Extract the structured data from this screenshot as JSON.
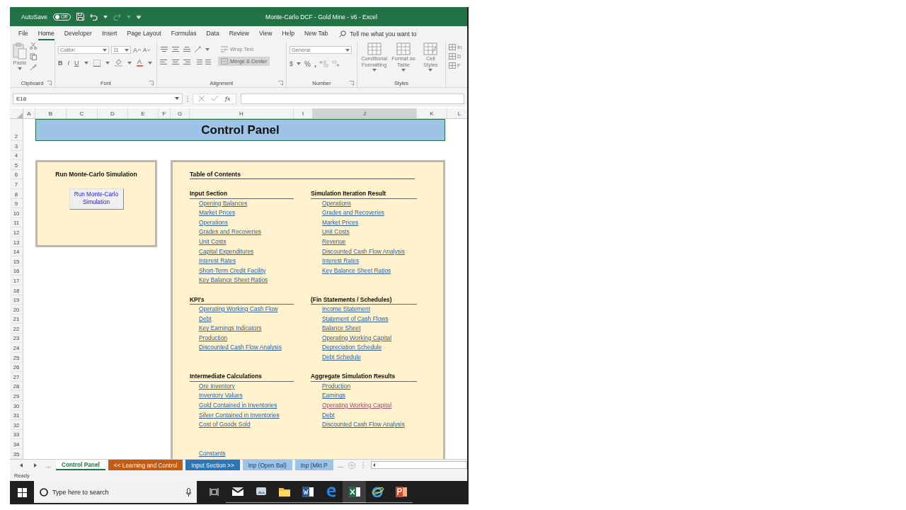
{
  "title_bar": {
    "autosave_label": "AutoSave",
    "autosave": {
      "on": false,
      "label": "Off"
    },
    "title": "Monte-Carlo DCF - Gold Mine - v6  -  Excel"
  },
  "menu_tabs": [
    {
      "label": "File",
      "selected": false
    },
    {
      "label": "Home",
      "selected": true
    },
    {
      "label": "Developer",
      "selected": false
    },
    {
      "label": "Insert",
      "selected": false
    },
    {
      "label": "Page Layout",
      "selected": false
    },
    {
      "label": "Formulas",
      "selected": false
    },
    {
      "label": "Data",
      "selected": false
    },
    {
      "label": "Review",
      "selected": false
    },
    {
      "label": "View",
      "selected": false
    },
    {
      "label": "Help",
      "selected": false
    },
    {
      "label": "New Tab",
      "selected": false
    }
  ],
  "tell_me": {
    "placeholder": "Tell me what you want to"
  },
  "ribbon": {
    "clipboard": {
      "paste": "Paste",
      "label": "Clipboard"
    },
    "font": {
      "name": "Calibri",
      "size": "11",
      "grow": "A",
      "shrink": "A",
      "bold": "B",
      "italic": "I",
      "underline": "U",
      "font_color_button": "A",
      "label": "Font"
    },
    "alignment": {
      "wrap": "Wrap Text",
      "merge": "Merge & Center",
      "label": "Alignment"
    },
    "number": {
      "format": "General",
      "currency": "$",
      "percent": "%",
      "comma": ",",
      "label": "Number"
    },
    "styles": {
      "items": [
        "Conditional Formatting",
        "Format as Table",
        "Cell Styles"
      ],
      "label": "Styles"
    },
    "cells_partial": [
      "In",
      "D",
      "F"
    ]
  },
  "formula_bar": {
    "name_box": "E18",
    "fx": "fx"
  },
  "column_headers": [
    {
      "label": "A",
      "selected": false
    },
    {
      "label": "B",
      "selected": false
    },
    {
      "label": "C",
      "selected": false
    },
    {
      "label": "D",
      "selected": false
    },
    {
      "label": "E",
      "selected": false
    },
    {
      "label": "F",
      "selected": false
    },
    {
      "label": "G",
      "selected": false
    },
    {
      "label": "H",
      "selected": false
    },
    {
      "label": "I",
      "selected": false
    },
    {
      "label": "J",
      "selected": true
    },
    {
      "label": "K",
      "selected": false
    },
    {
      "label": "L",
      "selected": false
    }
  ],
  "row_numbers": [
    "2",
    "3",
    "4",
    "5",
    "6",
    "7",
    "8",
    "9",
    "10",
    "11",
    "12",
    "13",
    "14",
    "15",
    "16",
    "17",
    "18",
    "19",
    "20",
    "21",
    "22",
    "23",
    "24",
    "25",
    "26",
    "27",
    "28",
    "29",
    "30",
    "31",
    "32",
    "33",
    "34",
    "35"
  ],
  "banner": {
    "title": "Control Panel"
  },
  "simulation_panel": {
    "title": "Run Monte-Carlo Simulation",
    "button": "Run Monte-Carlo Simulation"
  },
  "toc": {
    "title": "Table of Contents",
    "columns": [
      [
        {
          "heading": "Input Section",
          "links": [
            {
              "label": "Opening  Balances",
              "visited": false
            },
            {
              "label": "Market Prices",
              "visited": false
            },
            {
              "label": "Operations",
              "visited": false
            },
            {
              "label": "Grades and Recoveries",
              "visited": false
            },
            {
              "label": "Unit Costs",
              "visited": false
            },
            {
              "label": "Capital Expenditures",
              "visited": false
            },
            {
              "label": "Interest Rates",
              "visited": false
            },
            {
              "label": "Short-Term Credit Facility",
              "visited": false
            },
            {
              "label": "Key Balance Sheet Ratios",
              "visited": false
            }
          ]
        },
        {
          "heading": "KPI's",
          "links": [
            {
              "label": "Operating Working Cash Flow",
              "visited": false
            },
            {
              "label": "Debt",
              "visited": false
            },
            {
              "label": "Key Earnings Indicators",
              "visited": false
            },
            {
              "label": "Production",
              "visited": false
            },
            {
              "label": "Discounted Cash Flow Analysis",
              "visited": false
            }
          ]
        },
        {
          "heading": "Intermediate Calculations",
          "links": [
            {
              "label": "Ore Inventory",
              "visited": false
            },
            {
              "label": "Inventory Values",
              "visited": false
            },
            {
              "label": "Gold Contained in Inventories",
              "visited": false
            },
            {
              "label": "Silver Contained in Inventories",
              "visited": false
            },
            {
              "label": "Cost of Goods Sold",
              "visited": false
            }
          ]
        },
        {
          "links": [
            {
              "label": "Constants",
              "visited": false
            }
          ]
        }
      ],
      [
        {
          "heading": "Simulation Iteration Result",
          "links": [
            {
              "label": "Operations",
              "visited": false
            },
            {
              "label": "Grades and Recoveries",
              "visited": false
            },
            {
              "label": "Market Prices",
              "visited": false
            },
            {
              "label": "Unit Costs",
              "visited": false
            },
            {
              "label": "Revenue",
              "visited": false
            },
            {
              "label": "Discounted Cash Flow Analysis",
              "visited": false
            },
            {
              "label": "Interest Rates",
              "visited": false
            },
            {
              "label": "Key Balance Sheet Ratios",
              "visited": false
            }
          ]
        },
        {
          "heading": "(Fin Statements / Schedules)",
          "links": [
            {
              "label": "Income Statement",
              "visited": false
            },
            {
              "label": "Statement of Cash Flows",
              "visited": false
            },
            {
              "label": "Balance Sheet",
              "visited": false
            },
            {
              "label": "Operating Working Capital",
              "visited": false
            },
            {
              "label": "Depreciation Schedule",
              "visited": false
            },
            {
              "label": "Debt Schedule",
              "visited": false
            }
          ]
        },
        {
          "heading": "Aggregate Simulation Results",
          "links": [
            {
              "label": "Production",
              "visited": false
            },
            {
              "label": "Earnings",
              "visited": false
            },
            {
              "label": "Operating Working Capital",
              "visited": true
            },
            {
              "label": "Debt",
              "visited": false
            },
            {
              "label": "Discounted Cash Flow Analysis",
              "visited": false
            }
          ]
        }
      ]
    ]
  },
  "sheet_tabs": {
    "more_left": "...",
    "tabs": [
      {
        "label": "Control Panel",
        "selected": true,
        "color": "#ffffff"
      },
      {
        "label": "<< Learning and Control",
        "selected": false,
        "color": "#c55a11"
      },
      {
        "label": "Input Section >>",
        "selected": false,
        "color": "#2e75b6"
      },
      {
        "label": "Inp (Open Bal)",
        "selected": false,
        "color": "#9dc3e6"
      },
      {
        "label": "Inp (Mkt P",
        "selected": false,
        "color": "#9dc3e6"
      }
    ],
    "more_right": "..."
  },
  "status_bar": {
    "text": "Ready"
  },
  "taskbar": {
    "search": {
      "placeholder": "Type here to search"
    },
    "apps": [
      {
        "kind": "task-view",
        "selected": false
      },
      {
        "kind": "mail",
        "selected": false
      },
      {
        "kind": "photos",
        "selected": false
      },
      {
        "kind": "folder",
        "selected": false
      },
      {
        "kind": "word",
        "selected": false
      },
      {
        "kind": "edge",
        "selected": false
      },
      {
        "kind": "excel",
        "selected": true
      },
      {
        "kind": "ie",
        "selected": false
      },
      {
        "kind": "powerpoint",
        "selected": false
      }
    ]
  }
}
